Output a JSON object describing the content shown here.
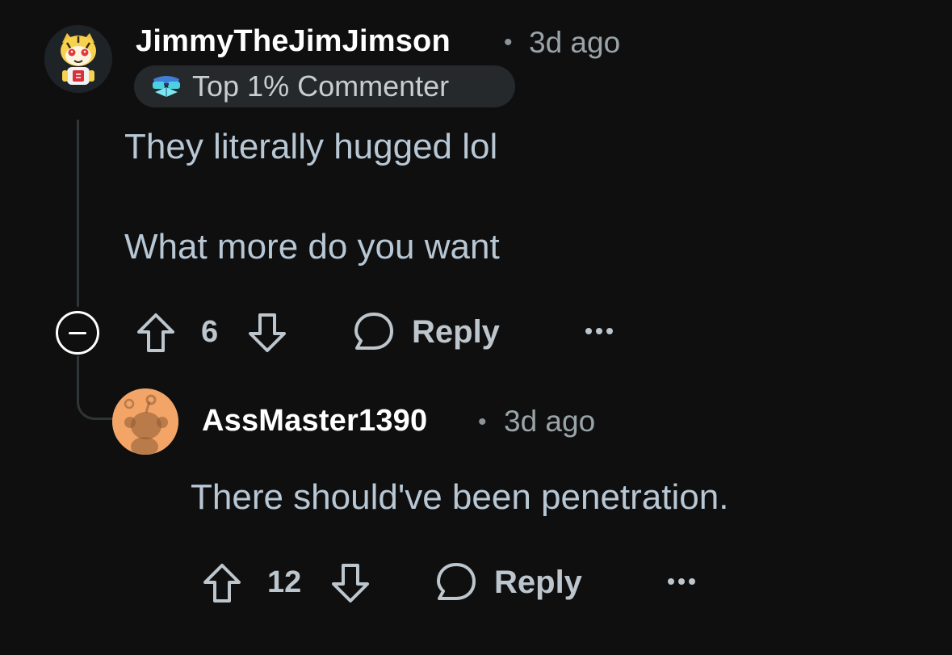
{
  "comments": [
    {
      "username": "JimmyTheJimJimson",
      "separator": "•",
      "time": "3d ago",
      "flair": "Top 1% Commenter",
      "body": [
        "They literally hugged lol",
        "What more do you want"
      ],
      "votes": "6",
      "reply_label": "Reply",
      "more_label": "•••",
      "avatar_icon": "snoo-tiger-avatar-icon"
    },
    {
      "username": "AssMaster1390",
      "separator": "•",
      "time": "3d ago",
      "body": [
        "There should've been penetration."
      ],
      "votes": "12",
      "reply_label": "Reply",
      "more_label": "•••",
      "avatar_icon": "default-snoo-avatar-icon"
    }
  ],
  "colors": {
    "background": "#0f0f10",
    "username": "#ffffff",
    "body_text": "#b7c7d4",
    "action_text": "#bcc6cc",
    "flair_bg": "#25292b",
    "thread_line": "#2f3436",
    "avatar2_bg": "#f3a568"
  }
}
